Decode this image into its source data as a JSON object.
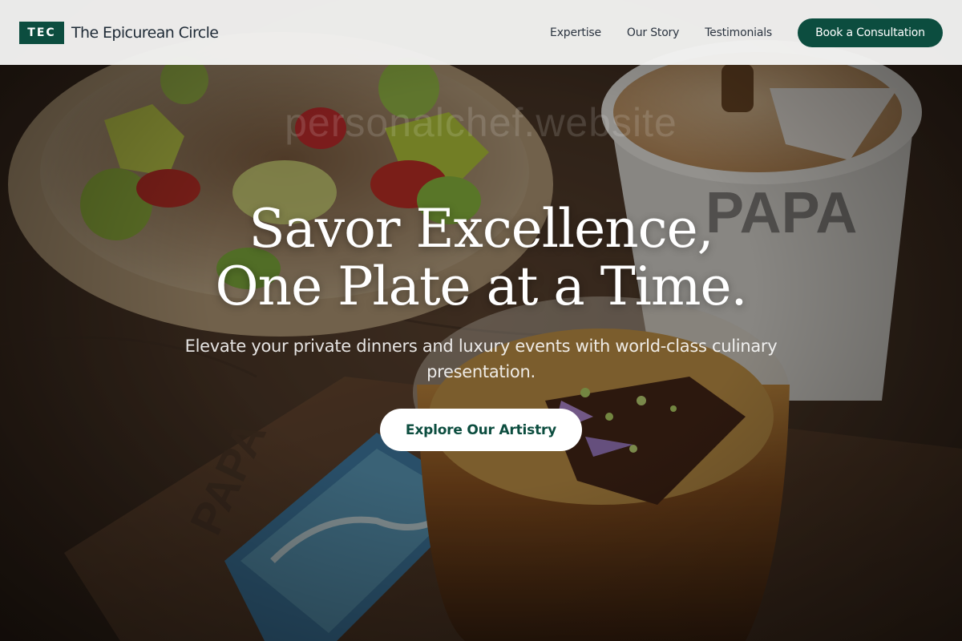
{
  "header": {
    "logo_badge": "TEC",
    "brand_name": "The Epicurean Circle",
    "nav": [
      {
        "label": "Expertise"
      },
      {
        "label": "Our Story"
      },
      {
        "label": "Testimonials"
      }
    ],
    "cta_label": "Book a Consultation"
  },
  "hero": {
    "headline_line1": "Savor Excellence,",
    "headline_line2": "One Plate at a Time.",
    "ghost_text": "personalchef.website",
    "subheading": "Elevate your private dinners and luxury events with world-class culinary presentation.",
    "button_label": "Explore Our Artistry",
    "background_description_icon": "food-photo-background"
  },
  "colors": {
    "brand_green": "#0c4d3f",
    "header_bg": "#f4f4f3",
    "text_dark": "#1e2a36",
    "white": "#ffffff"
  }
}
